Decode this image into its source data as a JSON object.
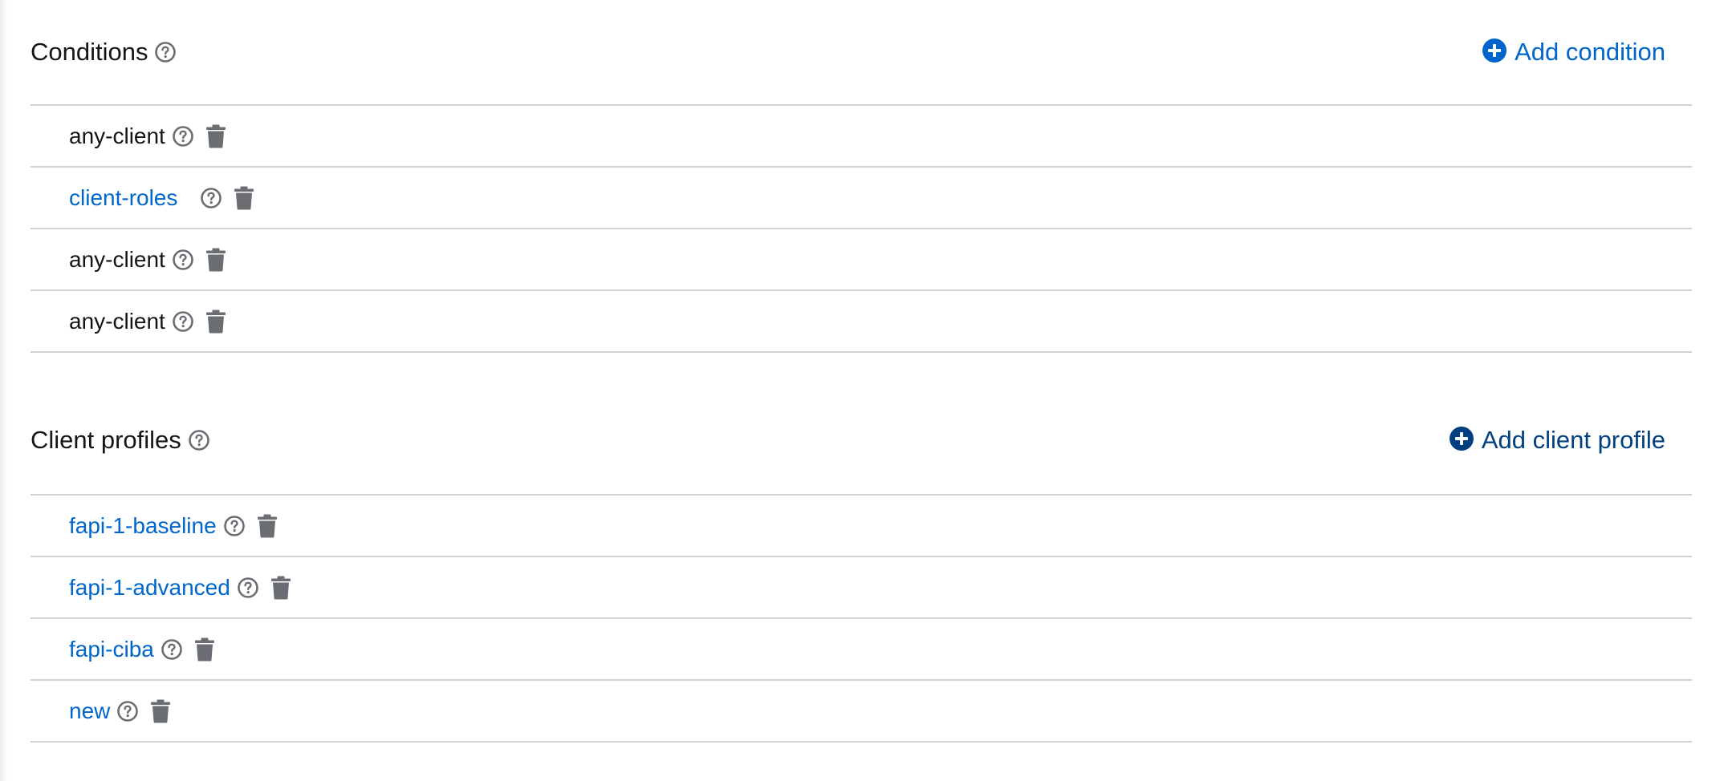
{
  "conditions": {
    "title": "Conditions",
    "help_icon": "question-circle-icon",
    "add_label": "Add condition",
    "add_icon": "plus-circle-icon",
    "items": [
      {
        "label": "any-client",
        "link": false
      },
      {
        "label": "client-roles",
        "link": true
      },
      {
        "label": "any-client",
        "link": false
      },
      {
        "label": "any-client",
        "link": false
      }
    ]
  },
  "client_profiles": {
    "title": "Client profiles",
    "help_icon": "question-circle-icon",
    "add_label": "Add client profile",
    "add_icon": "plus-circle-icon",
    "items": [
      {
        "label": "fapi-1-baseline",
        "link": true
      },
      {
        "label": "fapi-1-advanced",
        "link": true
      },
      {
        "label": "fapi-ciba",
        "link": true
      },
      {
        "label": "new",
        "link": true
      }
    ]
  },
  "row_icons": {
    "help": "question-circle-icon",
    "delete": "trash-icon"
  },
  "colors": {
    "link": "#0066cc",
    "link_dark": "#004080",
    "text": "#151515",
    "icon_gray": "#6a6e73",
    "divider": "#d2d2d2"
  }
}
